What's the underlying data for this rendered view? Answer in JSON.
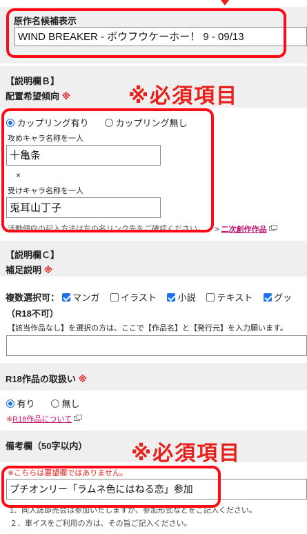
{
  "title_section": {
    "label": "原作名候補表示",
    "value": "WIND BREAKER - ボウフウケーホー！ 9 - 09/13"
  },
  "section_b": {
    "heading": "【説明欄Ｂ】",
    "label": "配置希望傾向",
    "required_mark": "※",
    "notice": "※必須項目",
    "radio_options": [
      "カップリング有り",
      "カップリング無し"
    ],
    "attacker_label": "攻めキャラ名称を一人",
    "attacker_value": "十亀条",
    "cross": "×",
    "receiver_label": "受けキャラ名称を一人",
    "receiver_value": "兎耳山丁子",
    "hint_text": "活動傾向の記入方法は左の名リンク先をご確認ください。",
    "link_prefix": ">",
    "link_text": "二次創作作品"
  },
  "section_c": {
    "heading": "【説明欄Ｃ】",
    "label": "補足説明",
    "required_mark": "※",
    "multi_label": "複数選択可：",
    "checkboxes": [
      "マンガ",
      "イラスト",
      "小説",
      "テキスト",
      "グッ"
    ],
    "r18_note": "（R18不可）",
    "instruction": "【該当作品なし】を選択の方は、ここで【作品名】と【発行元】を入力願います。",
    "input_value": ""
  },
  "r18_section": {
    "label": "R18作品の取扱い",
    "required_mark": "※",
    "radio_options": [
      "有り",
      "無し"
    ],
    "link_prefix": "※",
    "link_text": "R18作品について"
  },
  "remarks_section": {
    "label": "備考欄（50字以内）",
    "notice": "※必須項目",
    "warning": "※こちらは要望欄ではありません。",
    "input_value": "プチオンリー「ラムネ色にはねる恋」参加",
    "note1": "1．同人誌即売会は参加いたしますが、参加形式などをご記入ください。",
    "note2": "２．車イスをご利用の方は、その旨ご記入ください。"
  }
}
